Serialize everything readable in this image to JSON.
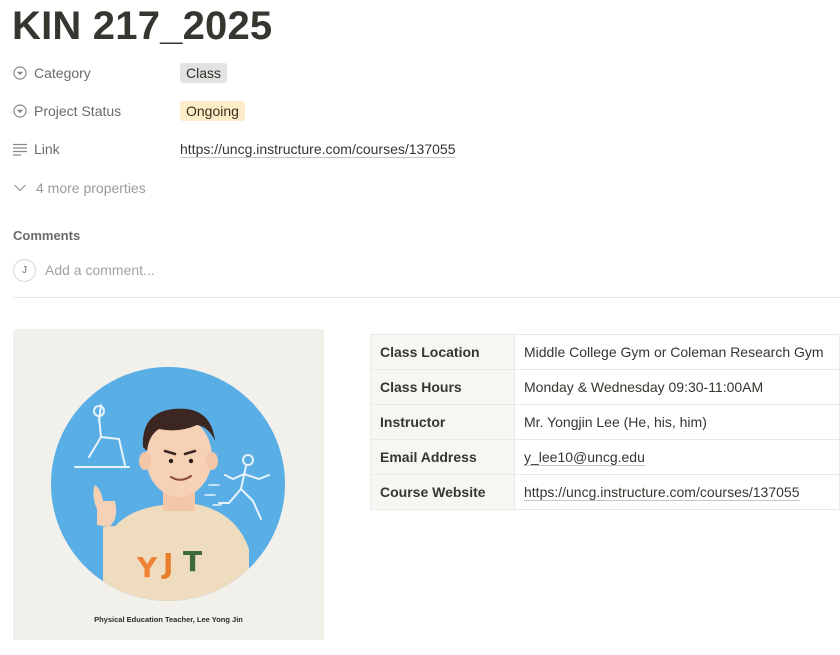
{
  "page": {
    "title": "KIN 217_2025"
  },
  "properties": {
    "category": {
      "name": "Category",
      "value": "Class",
      "icon": "chevron-circle-icon"
    },
    "status": {
      "name": "Project Status",
      "value": "Ongoing",
      "icon": "chevron-circle-icon"
    },
    "link": {
      "name": "Link",
      "value": "https://uncg.instructure.com/courses/137055",
      "icon": "lines-icon"
    },
    "more": "4 more properties"
  },
  "comments": {
    "heading": "Comments",
    "avatar_initial": "J",
    "placeholder": "Add a comment..."
  },
  "image": {
    "caption": "Physical Education Teacher, Lee Yong Jin",
    "shirt_letters": [
      "Y",
      "J",
      "T"
    ]
  },
  "info_table": {
    "rows": [
      {
        "key": "Class Location",
        "value": "Middle College Gym or Coleman Research Gym",
        "is_link": false
      },
      {
        "key": "Class Hours",
        "value": "Monday & Wednesday 09:30-11:00AM",
        "is_link": false
      },
      {
        "key": "Instructor",
        "value": "Mr. Yongjin Lee (He, his, him)",
        "is_link": false
      },
      {
        "key": "Email Address",
        "value": "y_lee10@uncg.edu",
        "is_link": true
      },
      {
        "key": "Course Website",
        "value": "https://uncg.instructure.com/courses/137055",
        "is_link": true
      }
    ]
  },
  "colors": {
    "text": "#37352f",
    "muted": "#9b9a97",
    "tag_gray": "#e3e2e0",
    "tag_orange": "#fdecc8",
    "table_key_bg": "#f7f6f3",
    "illustration_blue": "#5aaee6"
  }
}
